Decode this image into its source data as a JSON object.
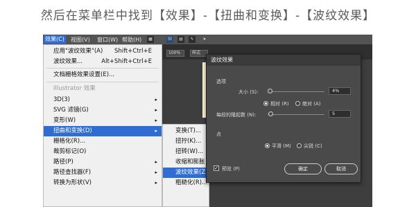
{
  "heading": "然后在菜单栏中找到【效果】-【扭曲和变换】-【波纹效果】",
  "menubar": {
    "items": [
      "效果(C)",
      "视图(V)",
      "窗口(W)",
      "帮助(H)"
    ],
    "icon_labels": [
      "St"
    ]
  },
  "toolbar": {
    "zoom": "100%",
    "style": "样式"
  },
  "effect_menu": {
    "apply_last": "应用\"波纹效果\"(A)",
    "apply_last_shortcut": "Shift+Ctrl+E",
    "last_effect": "波纹效果...",
    "last_effect_shortcut": "Alt+Shift+Ctrl+E",
    "raster_settings": "文档栅格效果设置(E)...",
    "section_illustrator": "Illustrator 效果",
    "items": [
      {
        "label": "3D(3)",
        "arrow": "▸"
      },
      {
        "label": "SVG 滤镜(G)",
        "arrow": "▸"
      },
      {
        "label": "变形(W)",
        "arrow": "▸"
      },
      {
        "label": "扭曲和变换(D)",
        "arrow": "▸"
      },
      {
        "label": "栅格化(R)...",
        "arrow": ""
      },
      {
        "label": "裁剪标记(O)",
        "arrow": ""
      },
      {
        "label": "路径(P)",
        "arrow": "▸"
      },
      {
        "label": "路径查找器(F)",
        "arrow": "▸"
      },
      {
        "label": "转换为形状(V)",
        "arrow": "▸"
      }
    ]
  },
  "distort_submenu": {
    "items": [
      "变换(T)...",
      "扭拧(K)...",
      "扭转(W)...",
      "收缩和膨胀",
      "波纹效果(Z)",
      "粗糙化(R)..."
    ]
  },
  "dialog": {
    "title": "波纹效果",
    "options_label": "选项",
    "size_label": "大小 (S):",
    "size_value": "4%",
    "size_level": 0.04,
    "relative_label": "相对 (R)",
    "absolute_label": "绝对 (A)",
    "ridges_label": "每段的隆起数 (N):",
    "ridges_value": "5",
    "ridges_level": 0.05,
    "points_label": "点",
    "smooth_label": "平滑 (M)",
    "corner_label": "尖锐 (C)",
    "preview_label": "预览 (P)",
    "ok_label": "确定",
    "cancel_label": "取消"
  }
}
